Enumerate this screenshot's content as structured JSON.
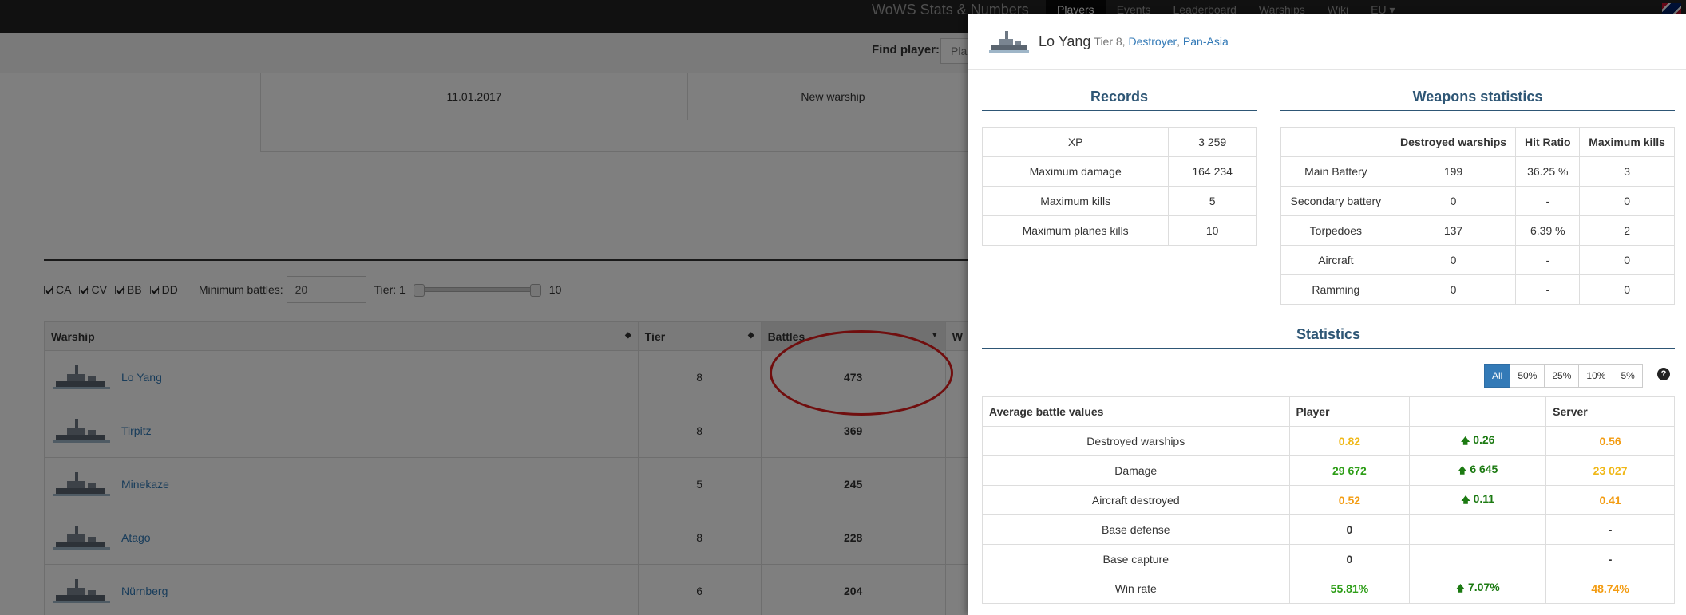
{
  "navbar": {
    "brand": "WoWS Stats & Numbers",
    "links": [
      "Players",
      "Events",
      "Leaderboard",
      "Warships",
      "Wiki",
      "EU ▾"
    ],
    "active": "Players"
  },
  "find": {
    "label": "Find player:",
    "placeholder": "Pla"
  },
  "event": {
    "date": "11.01.2017",
    "type": "New warship"
  },
  "filters": {
    "classes": [
      "CA",
      "CV",
      "BB",
      "DD"
    ],
    "min_battles_label": "Minimum battles:",
    "min_battles_value": "20",
    "tier_label": "Tier: 1",
    "tier_max": "10"
  },
  "warship_table": {
    "headers": [
      "Warship",
      "Tier",
      "Battles",
      "W"
    ],
    "rows": [
      {
        "name": "Lo Yang",
        "tier": "8",
        "battles": "473"
      },
      {
        "name": "Tirpitz",
        "tier": "8",
        "battles": "369"
      },
      {
        "name": "Minekaze",
        "tier": "5",
        "battles": "245"
      },
      {
        "name": "Atago",
        "tier": "8",
        "battles": "228"
      },
      {
        "name": "Nürnberg",
        "tier": "6",
        "battles": "204"
      }
    ]
  },
  "modal": {
    "ship_name": "Lo Yang",
    "tier_text": "Tier 8,",
    "class_link": "Destroyer",
    "nation_link": "Pan-Asia",
    "records": {
      "title": "Records",
      "rows": [
        {
          "label": "XP",
          "value": "3 259"
        },
        {
          "label": "Maximum damage",
          "value": "164 234"
        },
        {
          "label": "Maximum kills",
          "value": "5"
        },
        {
          "label": "Maximum planes kills",
          "value": "10"
        }
      ]
    },
    "weapons": {
      "title": "Weapons statistics",
      "headers": [
        "",
        "Destroyed warships",
        "Hit Ratio",
        "Maximum kills"
      ],
      "rows": [
        {
          "name": "Main Battery",
          "destroyed": "199",
          "ratio": "36.25 %",
          "max": "3"
        },
        {
          "name": "Secondary battery",
          "destroyed": "0",
          "ratio": "-",
          "max": "0"
        },
        {
          "name": "Torpedoes",
          "destroyed": "137",
          "ratio": "6.39 %",
          "max": "2"
        },
        {
          "name": "Aircraft",
          "destroyed": "0",
          "ratio": "-",
          "max": "0"
        },
        {
          "name": "Ramming",
          "destroyed": "0",
          "ratio": "-",
          "max": "0"
        }
      ]
    },
    "statistics": {
      "title": "Statistics",
      "filters": [
        "All",
        "50%",
        "25%",
        "10%",
        "5%"
      ],
      "active_filter": "All",
      "help": "?",
      "headers": [
        "Average battle values",
        "Player",
        "",
        "Server"
      ],
      "rows": [
        {
          "label": "Destroyed warships",
          "player": "0.82",
          "diff": "0.26",
          "server": "0.56"
        },
        {
          "label": "Damage",
          "player": "29 672",
          "diff": "6 645",
          "server": "23 027"
        },
        {
          "label": "Aircraft destroyed",
          "player": "0.52",
          "diff": "0.11",
          "server": "0.41"
        },
        {
          "label": "Base defense",
          "player": "0",
          "diff": "",
          "server": "-"
        },
        {
          "label": "Base capture",
          "player": "0",
          "diff": "",
          "server": "-"
        },
        {
          "label": "Win rate",
          "player": "55.81%",
          "diff": "7.07%",
          "server": "48.74%"
        }
      ],
      "colors": {
        "good": "#2e9e18",
        "average": "#f0b818",
        "below": "#f39c12",
        "up_arrow": "#1c7a12"
      }
    }
  }
}
